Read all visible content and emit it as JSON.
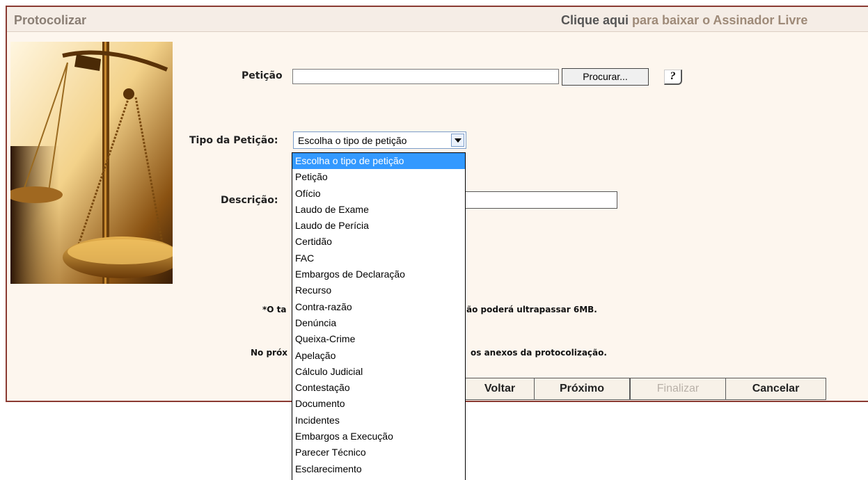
{
  "header": {
    "title": "Protocolizar",
    "link_text": "Clique aqui",
    "link_rest": " para baixar o Assinador Livre"
  },
  "form": {
    "peticao_label": "Petição",
    "browse_label": "Procurar...",
    "help_label": "?",
    "tipo_label": "Tipo da Petição:",
    "tipo_selected": "Escolha o tipo de petição",
    "descricao_label": "Descrição:"
  },
  "notes": {
    "size_prefix": "*O ta",
    "size_suffix": "ão poderá ultrapassar 6MB.",
    "next_prefix": "No próx",
    "next_suffix": "os anexos da protocolização."
  },
  "buttons": {
    "back": "Voltar",
    "next": "Próximo",
    "finish": "Finalizar",
    "cancel": "Cancelar"
  },
  "dropdown": {
    "options": [
      "Escolha o tipo de petição",
      "Petição",
      "Ofício",
      "Laudo de Exame",
      "Laudo de Perícia",
      "Certidão",
      "FAC",
      "Embargos de Declaração",
      "Recurso",
      "Contra-razão",
      "Denúncia",
      "Queixa-Crime",
      "Apelação",
      "Cálculo Judicial",
      "Contestação",
      "Documento",
      "Incidentes",
      "Embargos a Execução",
      "Parecer Técnico",
      "Esclarecimento"
    ],
    "selected_index": 0
  },
  "colors": {
    "border": "#8a3a32",
    "panel_bg": "#fdf6ee",
    "highlight": "#3399ff"
  }
}
